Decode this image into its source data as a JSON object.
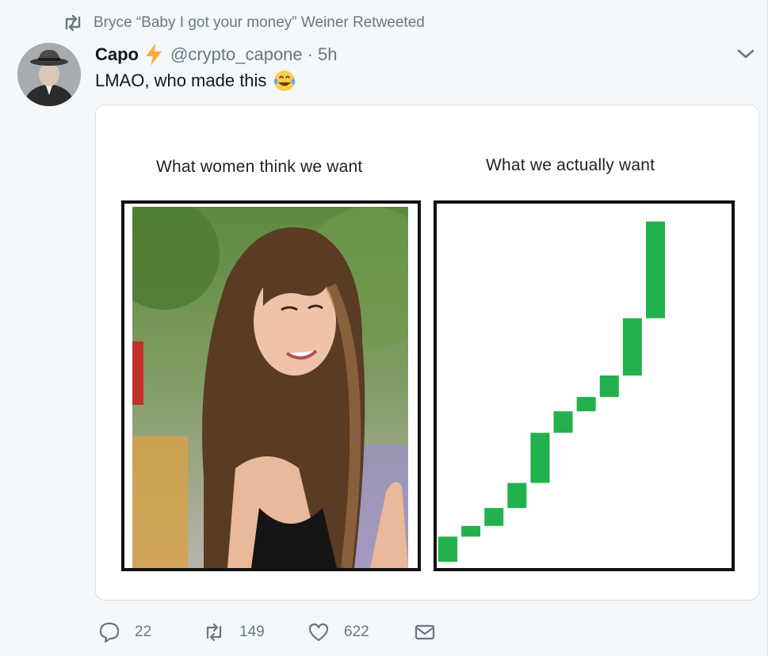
{
  "retweet_context": {
    "text": "Bryce “Baby I got your money” Weiner Retweeted",
    "icon": "retweet-icon"
  },
  "author": {
    "name": "Capo",
    "handle": "@crypto_capone",
    "separator": "·",
    "time": "5h",
    "badge_icon": "lightning-bolt-emoji",
    "avatar_icon": "avatar-man-in-fedora"
  },
  "tweet": {
    "text": "LMAO, who made this",
    "emoji": "face-with-tears-of-joy-emoji"
  },
  "menu": {
    "icon": "chevron-down-icon"
  },
  "media": {
    "left_caption": "What women think we want",
    "right_caption": "What we actually want",
    "left_image": "photo-smiling-woman-long-brown-hair",
    "colors": {
      "candles": "#22b14c",
      "frame": "#111111"
    }
  },
  "chart_data": {
    "type": "candlestick",
    "title": "What we actually want",
    "xlabel": "",
    "ylabel": "",
    "candles": [
      {
        "open": 0,
        "close": 7
      },
      {
        "open": 7,
        "close": 10
      },
      {
        "open": 10,
        "close": 15
      },
      {
        "open": 15,
        "close": 22
      },
      {
        "open": 22,
        "close": 36
      },
      {
        "open": 36,
        "close": 42
      },
      {
        "open": 42,
        "close": 46
      },
      {
        "open": 46,
        "close": 52
      },
      {
        "open": 52,
        "close": 68
      },
      {
        "open": 68,
        "close": 95
      }
    ],
    "ylim": [
      0,
      100
    ],
    "grid": false,
    "color": "#22b14c"
  },
  "actions": {
    "reply": {
      "icon": "reply-icon",
      "count": "22"
    },
    "retweet": {
      "icon": "retweet-icon",
      "count": "149"
    },
    "like": {
      "icon": "heart-icon",
      "count": "622"
    },
    "dm": {
      "icon": "envelope-icon"
    }
  }
}
